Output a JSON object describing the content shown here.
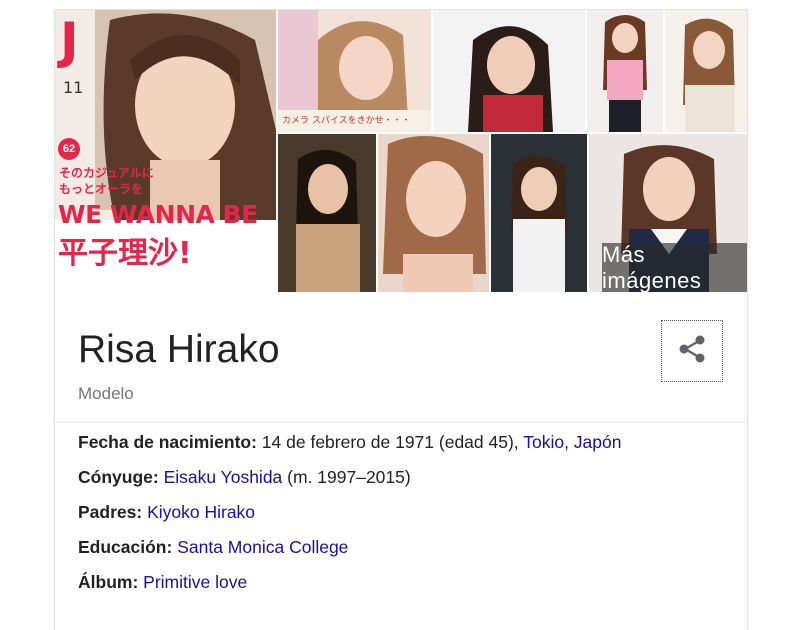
{
  "gallery": {
    "more_images_label": "Más imágenes",
    "cover": {
      "logo": "J",
      "issue": "11",
      "badge": "62",
      "line1": "そのカジュアルに",
      "line2": "もっとオーラを",
      "headline": "WE WANNA BE",
      "name": "平子理沙!"
    },
    "photo2_caption": "カメラ スパイスをきかせ・・・"
  },
  "entity": {
    "name": "Risa Hirako",
    "type": "Modelo"
  },
  "facts": [
    {
      "key": "Fecha de nacimiento:",
      "text": " 14 de febrero de 1971 (edad 45), ",
      "link": "Tokio, Japón",
      "after": ""
    },
    {
      "key": "Cónyuge:",
      "text": " ",
      "link": "Eisaku Yoshida",
      "after": " (m. 1997–2015)"
    },
    {
      "key": "Padres:",
      "text": " ",
      "link": "Kiyoko Hirako",
      "after": ""
    },
    {
      "key": "Educación:",
      "text": " ",
      "link": "Santa Monica College",
      "after": ""
    },
    {
      "key": "Álbum:",
      "text": " ",
      "link": "Primitive love",
      "after": ""
    }
  ],
  "colors": {
    "link": "#1a0dab",
    "title": "#222222",
    "subtitle": "#777777",
    "cover_red": "#e5264a"
  },
  "icons": {
    "share": "share-icon"
  }
}
